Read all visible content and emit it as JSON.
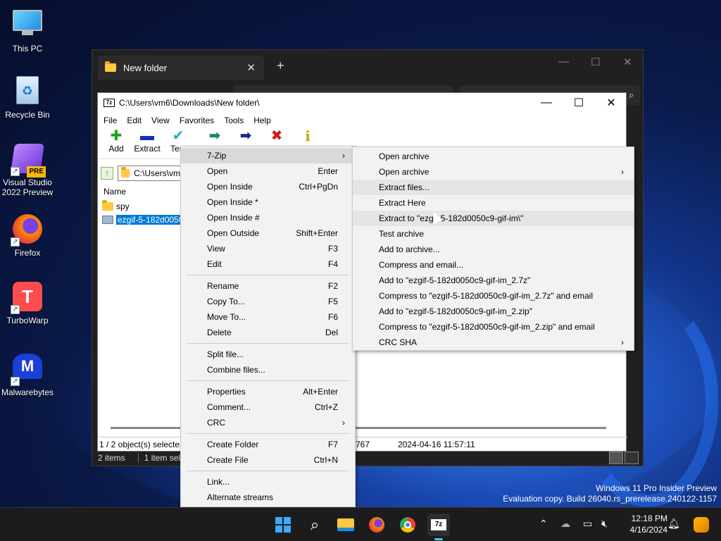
{
  "desktop": {
    "icons": [
      {
        "label": "This PC",
        "icon": "monitor-icon"
      },
      {
        "label": "Recycle Bin",
        "icon": "recycle-bin-icon"
      },
      {
        "label": "Visual Studio 2022 Preview",
        "icon": "visual-studio-icon",
        "badge": "PRE"
      },
      {
        "label": "Firefox",
        "icon": "firefox-icon"
      },
      {
        "label": "TurboWarp",
        "icon": "turbowarp-icon"
      },
      {
        "label": "Malwarebytes",
        "icon": "malwarebytes-icon"
      }
    ]
  },
  "explorer": {
    "tab_title": "New folder",
    "tab_close": "✕",
    "new_tab": "+",
    "controls": {
      "minimize": "—",
      "maximize": "☐",
      "close": "✕"
    },
    "status": {
      "items": "2 items",
      "selected": "1 item sele"
    }
  },
  "zip": {
    "title": "C:\\Users\\vm6\\Downloads\\New folder\\",
    "logo": "7z",
    "controls": {
      "minimize": "—",
      "maximize": "☐",
      "close": "✕"
    },
    "menu": [
      "File",
      "Edit",
      "View",
      "Favorites",
      "Tools",
      "Help"
    ],
    "toolbar": [
      {
        "label": "Add",
        "glyph": "✚",
        "color": "#1aa31a"
      },
      {
        "label": "Extract",
        "glyph": "▬",
        "color": "#1a2fb8"
      },
      {
        "label": "Test",
        "glyph": "✔",
        "color": "#1ab3b3"
      }
    ],
    "toolbar_icons": [
      {
        "glyph": "➡",
        "color": "#1a8a6a"
      },
      {
        "glyph": "➡",
        "color": "#1a2a8a"
      },
      {
        "glyph": "✖",
        "color": "#d11a1a"
      },
      {
        "glyph": "i",
        "color": "#c9a800"
      }
    ],
    "address": "C:\\Users\\vm",
    "column_name": "Name",
    "files": [
      {
        "name": "spy",
        "type": "folder"
      },
      {
        "name": "ezgif-5-182d0050c",
        "type": "archive",
        "selected": true
      }
    ],
    "status": {
      "selected": "1 / 2 object(s) selecte",
      "size": "767",
      "modified": "2024-04-16 11:57:11"
    }
  },
  "context_menu": {
    "items": [
      {
        "label": "7-Zip",
        "submenu": true
      },
      {
        "label": "Open",
        "shortcut": "Enter"
      },
      {
        "label": "Open Inside",
        "shortcut": "Ctrl+PgDn"
      },
      {
        "label": "Open Inside *",
        "shortcut": ""
      },
      {
        "label": "Open Inside #",
        "shortcut": ""
      },
      {
        "label": "Open Outside",
        "shortcut": "Shift+Enter"
      },
      {
        "label": "View",
        "shortcut": "F3"
      },
      {
        "label": "Edit",
        "shortcut": "F4"
      },
      {
        "sep": true
      },
      {
        "label": "Rename",
        "shortcut": "F2"
      },
      {
        "label": "Copy To...",
        "shortcut": "F5"
      },
      {
        "label": "Move To...",
        "shortcut": "F6"
      },
      {
        "label": "Delete",
        "shortcut": "Del"
      },
      {
        "sep": true
      },
      {
        "label": "Split file...",
        "shortcut": ""
      },
      {
        "label": "Combine files...",
        "shortcut": ""
      },
      {
        "sep": true
      },
      {
        "label": "Properties",
        "shortcut": "Alt+Enter"
      },
      {
        "label": "Comment...",
        "shortcut": "Ctrl+Z"
      },
      {
        "label": "CRC",
        "submenu": true
      },
      {
        "sep": true
      },
      {
        "label": "Create Folder",
        "shortcut": "F7"
      },
      {
        "label": "Create File",
        "shortcut": "Ctrl+N"
      },
      {
        "sep": true
      },
      {
        "label": "Link...",
        "shortcut": ""
      },
      {
        "label": "Alternate streams",
        "shortcut": ""
      }
    ]
  },
  "submenu": {
    "items": [
      {
        "label": "Open archive"
      },
      {
        "label": "Open archive",
        "submenu": true
      },
      {
        "label": "Extract files...",
        "hover": true
      },
      {
        "label": "Extract Here"
      },
      {
        "label": "Extract to \"ezgif-5-182d0050c9-gif-im\\\"",
        "hover": true
      },
      {
        "label": "Test archive"
      },
      {
        "label": "Add to archive..."
      },
      {
        "label": "Compress and email..."
      },
      {
        "label": "Add to \"ezgif-5-182d0050c9-gif-im_2.7z\""
      },
      {
        "label": "Compress to \"ezgif-5-182d0050c9-gif-im_2.7z\" and email"
      },
      {
        "label": "Add to \"ezgif-5-182d0050c9-gif-im_2.zip\""
      },
      {
        "label": "Compress to \"ezgif-5-182d0050c9-gif-im_2.zip\" and email"
      },
      {
        "label": "CRC SHA",
        "submenu": true
      }
    ]
  },
  "watermark": {
    "line1": "Windows 11 Pro Insider Preview",
    "line2": "Evaluation copy. Build 26040.rs_prerelease.240122-1157"
  },
  "taskbar": {
    "apps": [
      "start-icon",
      "search-icon",
      "file-explorer-icon",
      "firefox-icon",
      "chrome-icon",
      "7zip-icon"
    ],
    "time": "12:18 PM",
    "date": "4/16/2024"
  }
}
